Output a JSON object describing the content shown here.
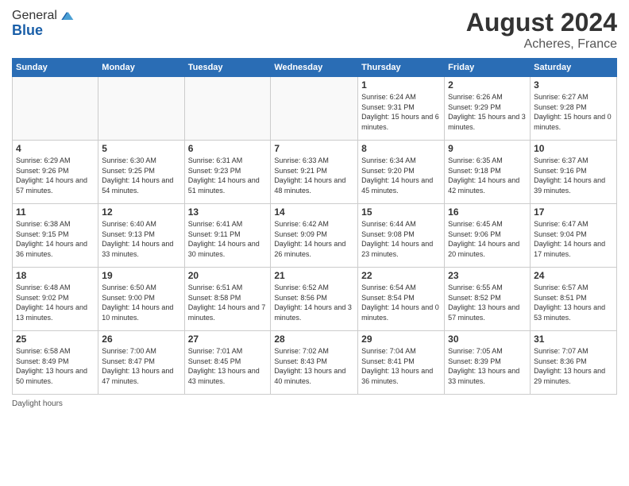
{
  "logo": {
    "line1": "General",
    "line2": "Blue"
  },
  "title": {
    "month_year": "August 2024",
    "location": "Acheres, France"
  },
  "days_header": [
    "Sunday",
    "Monday",
    "Tuesday",
    "Wednesday",
    "Thursday",
    "Friday",
    "Saturday"
  ],
  "weeks": [
    [
      {
        "num": "",
        "info": ""
      },
      {
        "num": "",
        "info": ""
      },
      {
        "num": "",
        "info": ""
      },
      {
        "num": "",
        "info": ""
      },
      {
        "num": "1",
        "info": "Sunrise: 6:24 AM\nSunset: 9:31 PM\nDaylight: 15 hours and 6 minutes."
      },
      {
        "num": "2",
        "info": "Sunrise: 6:26 AM\nSunset: 9:29 PM\nDaylight: 15 hours and 3 minutes."
      },
      {
        "num": "3",
        "info": "Sunrise: 6:27 AM\nSunset: 9:28 PM\nDaylight: 15 hours and 0 minutes."
      }
    ],
    [
      {
        "num": "4",
        "info": "Sunrise: 6:29 AM\nSunset: 9:26 PM\nDaylight: 14 hours and 57 minutes."
      },
      {
        "num": "5",
        "info": "Sunrise: 6:30 AM\nSunset: 9:25 PM\nDaylight: 14 hours and 54 minutes."
      },
      {
        "num": "6",
        "info": "Sunrise: 6:31 AM\nSunset: 9:23 PM\nDaylight: 14 hours and 51 minutes."
      },
      {
        "num": "7",
        "info": "Sunrise: 6:33 AM\nSunset: 9:21 PM\nDaylight: 14 hours and 48 minutes."
      },
      {
        "num": "8",
        "info": "Sunrise: 6:34 AM\nSunset: 9:20 PM\nDaylight: 14 hours and 45 minutes."
      },
      {
        "num": "9",
        "info": "Sunrise: 6:35 AM\nSunset: 9:18 PM\nDaylight: 14 hours and 42 minutes."
      },
      {
        "num": "10",
        "info": "Sunrise: 6:37 AM\nSunset: 9:16 PM\nDaylight: 14 hours and 39 minutes."
      }
    ],
    [
      {
        "num": "11",
        "info": "Sunrise: 6:38 AM\nSunset: 9:15 PM\nDaylight: 14 hours and 36 minutes."
      },
      {
        "num": "12",
        "info": "Sunrise: 6:40 AM\nSunset: 9:13 PM\nDaylight: 14 hours and 33 minutes."
      },
      {
        "num": "13",
        "info": "Sunrise: 6:41 AM\nSunset: 9:11 PM\nDaylight: 14 hours and 30 minutes."
      },
      {
        "num": "14",
        "info": "Sunrise: 6:42 AM\nSunset: 9:09 PM\nDaylight: 14 hours and 26 minutes."
      },
      {
        "num": "15",
        "info": "Sunrise: 6:44 AM\nSunset: 9:08 PM\nDaylight: 14 hours and 23 minutes."
      },
      {
        "num": "16",
        "info": "Sunrise: 6:45 AM\nSunset: 9:06 PM\nDaylight: 14 hours and 20 minutes."
      },
      {
        "num": "17",
        "info": "Sunrise: 6:47 AM\nSunset: 9:04 PM\nDaylight: 14 hours and 17 minutes."
      }
    ],
    [
      {
        "num": "18",
        "info": "Sunrise: 6:48 AM\nSunset: 9:02 PM\nDaylight: 14 hours and 13 minutes."
      },
      {
        "num": "19",
        "info": "Sunrise: 6:50 AM\nSunset: 9:00 PM\nDaylight: 14 hours and 10 minutes."
      },
      {
        "num": "20",
        "info": "Sunrise: 6:51 AM\nSunset: 8:58 PM\nDaylight: 14 hours and 7 minutes."
      },
      {
        "num": "21",
        "info": "Sunrise: 6:52 AM\nSunset: 8:56 PM\nDaylight: 14 hours and 3 minutes."
      },
      {
        "num": "22",
        "info": "Sunrise: 6:54 AM\nSunset: 8:54 PM\nDaylight: 14 hours and 0 minutes."
      },
      {
        "num": "23",
        "info": "Sunrise: 6:55 AM\nSunset: 8:52 PM\nDaylight: 13 hours and 57 minutes."
      },
      {
        "num": "24",
        "info": "Sunrise: 6:57 AM\nSunset: 8:51 PM\nDaylight: 13 hours and 53 minutes."
      }
    ],
    [
      {
        "num": "25",
        "info": "Sunrise: 6:58 AM\nSunset: 8:49 PM\nDaylight: 13 hours and 50 minutes."
      },
      {
        "num": "26",
        "info": "Sunrise: 7:00 AM\nSunset: 8:47 PM\nDaylight: 13 hours and 47 minutes."
      },
      {
        "num": "27",
        "info": "Sunrise: 7:01 AM\nSunset: 8:45 PM\nDaylight: 13 hours and 43 minutes."
      },
      {
        "num": "28",
        "info": "Sunrise: 7:02 AM\nSunset: 8:43 PM\nDaylight: 13 hours and 40 minutes."
      },
      {
        "num": "29",
        "info": "Sunrise: 7:04 AM\nSunset: 8:41 PM\nDaylight: 13 hours and 36 minutes."
      },
      {
        "num": "30",
        "info": "Sunrise: 7:05 AM\nSunset: 8:39 PM\nDaylight: 13 hours and 33 minutes."
      },
      {
        "num": "31",
        "info": "Sunrise: 7:07 AM\nSunset: 8:36 PM\nDaylight: 13 hours and 29 minutes."
      }
    ]
  ],
  "footer": {
    "label": "Daylight hours"
  }
}
